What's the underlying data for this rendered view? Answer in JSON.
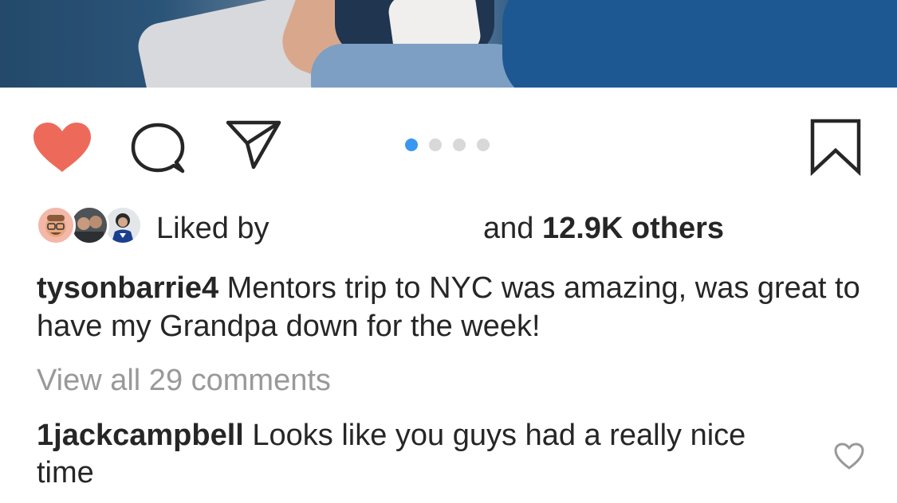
{
  "post": {
    "photo": {
      "description_icon": "photo-icon"
    },
    "actions": {
      "like_icon": "heart-filled-icon",
      "comment_icon": "comment-icon",
      "share_icon": "direct-share-icon",
      "save_icon": "bookmark-icon",
      "liked": true,
      "like_color": "#ed6a5a"
    },
    "carousel": {
      "total": 4,
      "active_index": 0,
      "active_color": "#3897f0",
      "inactive_color": "#d8d8d8"
    },
    "likes": {
      "prefix": "Liked by",
      "suffix_and": "and",
      "count_text": "12.9K others"
    },
    "caption": {
      "username": "tysonbarrie4",
      "text": "Mentors trip to NYC was amazing, was great to have my Grandpa down for the week!"
    },
    "comments": {
      "view_all": "View all 29 comments",
      "items": [
        {
          "username": "1jackcampbell",
          "text": "Looks like you guys had a really nice time",
          "like_icon": "heart-outline-icon"
        }
      ]
    }
  }
}
